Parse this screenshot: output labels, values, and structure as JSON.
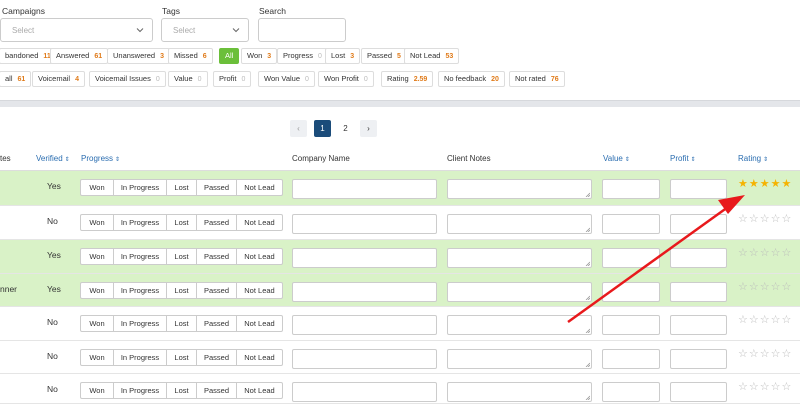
{
  "filters": {
    "campaigns_label": "Campaigns",
    "campaigns_placeholder": "Select",
    "tags_label": "Tags",
    "tags_placeholder": "Select",
    "search_label": "Search",
    "row1": [
      {
        "label": "bandoned",
        "count": "11"
      },
      {
        "label": "Answered",
        "count": "61"
      },
      {
        "label": "Unanswered",
        "count": "3"
      },
      {
        "label": "Missed",
        "count": "6"
      },
      {
        "label": "All",
        "count": ""
      },
      {
        "label": "Won",
        "count": "3"
      },
      {
        "label": "Progress",
        "count": "0"
      },
      {
        "label": "Lost",
        "count": "3"
      },
      {
        "label": "Passed",
        "count": "5"
      },
      {
        "label": "Not Lead",
        "count": "53"
      }
    ],
    "row2": [
      {
        "label": "all",
        "count": "61"
      },
      {
        "label": "Voicemail",
        "count": "4"
      },
      {
        "label": "Voicemail Issues",
        "count": "0"
      },
      {
        "label": "Value",
        "count": "0"
      },
      {
        "label": "Profit",
        "count": "0"
      },
      {
        "label": "Won Value",
        "count": "0"
      },
      {
        "label": "Won Profit",
        "count": "0"
      },
      {
        "label": "Rating",
        "count": "2.59"
      },
      {
        "label": "No feedback",
        "count": "20"
      },
      {
        "label": "Not rated",
        "count": "76"
      }
    ]
  },
  "pagination": {
    "prev": "‹",
    "page1": "1",
    "page2": "2",
    "next": "›"
  },
  "columns": {
    "name": "tes",
    "verified": "Verified",
    "progress": "Progress",
    "company": "Company Name",
    "notes": "Client Notes",
    "value": "Value",
    "profit": "Profit",
    "rating": "Rating",
    "sort": "⇕"
  },
  "progress_options": [
    "Won",
    "In Progress",
    "Lost",
    "Passed",
    "Not Lead"
  ],
  "rows": [
    {
      "name": "",
      "verified": "Yes",
      "green": true,
      "stars": "★★★★★",
      "rated": true
    },
    {
      "name": "",
      "verified": "No",
      "green": false,
      "stars": "☆☆☆☆☆",
      "rated": false
    },
    {
      "name": "",
      "verified": "Yes",
      "green": true,
      "stars": "☆☆☆☆☆",
      "rated": false
    },
    {
      "name": "nner",
      "verified": "Yes",
      "green": true,
      "stars": "☆☆☆☆☆",
      "rated": false
    },
    {
      "name": "",
      "verified": "No",
      "green": false,
      "stars": "☆☆☆☆☆",
      "rated": false
    },
    {
      "name": "",
      "verified": "No",
      "green": false,
      "stars": "☆☆☆☆☆",
      "rated": false
    },
    {
      "name": "",
      "verified": "No",
      "green": false,
      "stars": "☆☆☆☆☆",
      "rated": false
    }
  ],
  "colors": {
    "accent": "#6bbf3a",
    "pager_active": "#1b4c7a",
    "row_green": "#d9f2c7",
    "star": "#f5b301",
    "arrow": "#e8191c"
  },
  "icons": {
    "select_chevron": "chevron-down-icon",
    "annotation": "red-arrow-icon"
  }
}
